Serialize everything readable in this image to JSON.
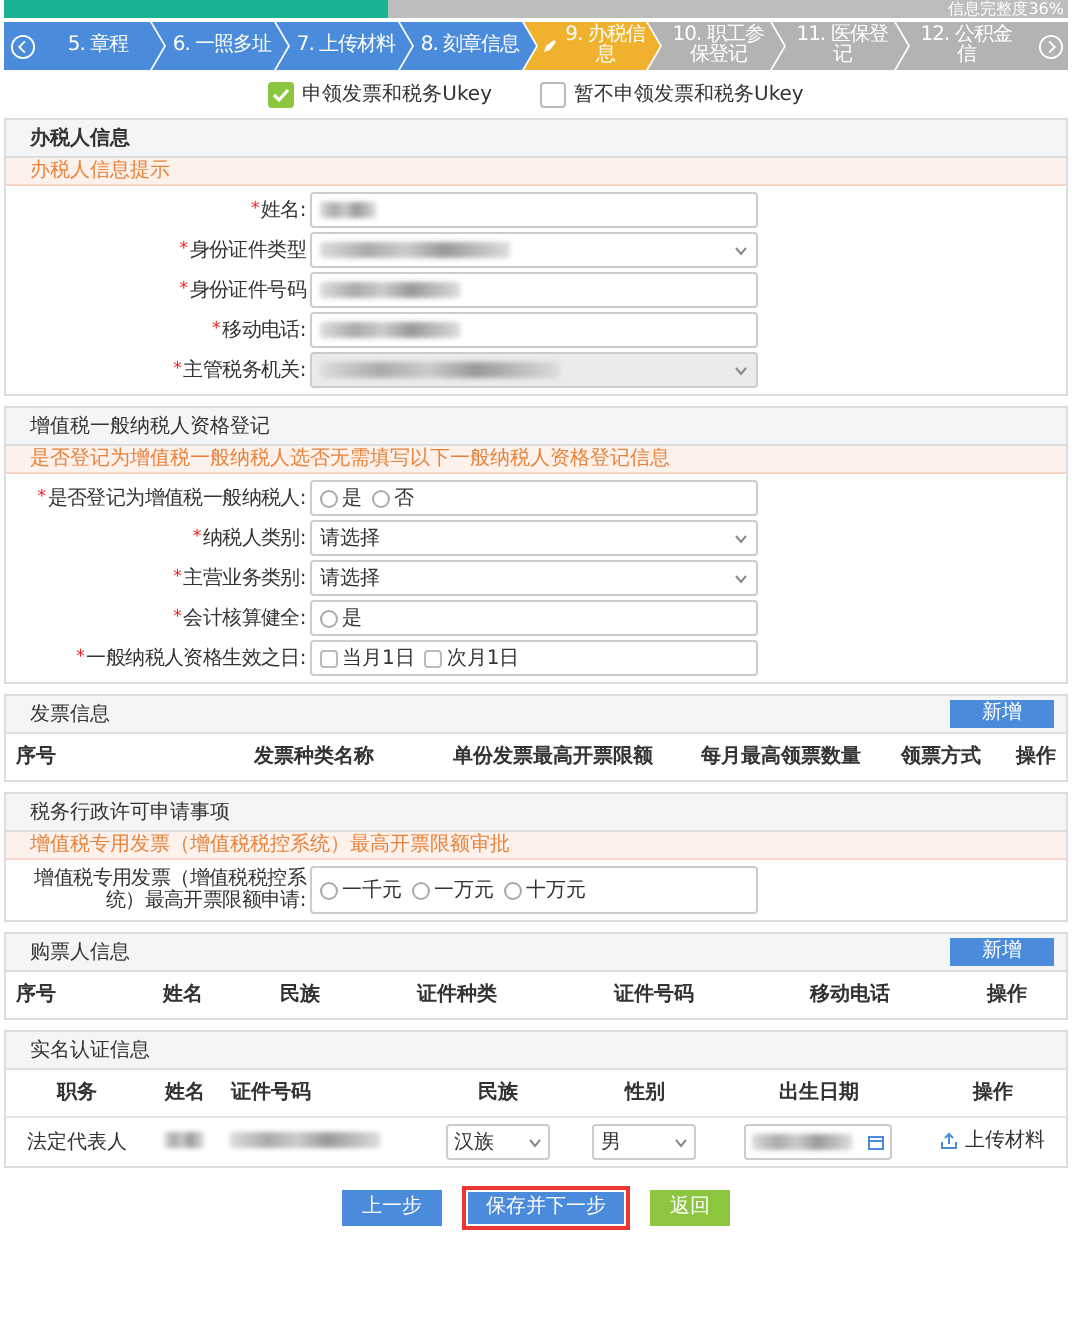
{
  "progress": {
    "level": 0.36,
    "label": "信息完整度36%"
  },
  "steps": [
    {
      "label": "5. 章程",
      "completed": true,
      "selected": false
    },
    {
      "label": "6. 一照多址",
      "completed": true,
      "selected": false
    },
    {
      "label": "7. 上传材料",
      "completed": true,
      "selected": false
    },
    {
      "label": "8. 刻章信息",
      "completed": true,
      "selected": false
    },
    {
      "label": "9. 办税信息",
      "selected": true
    },
    {
      "label": "10. 职工参保登记",
      "completed": false,
      "selected": false
    },
    {
      "label": "11. 医保登记",
      "completed": false,
      "selected": false
    },
    {
      "label": "12. 公积金信",
      "completed": false,
      "selected": false
    }
  ],
  "ukey_options": [
    {
      "label": "申领发票和税务Ukey",
      "checked": true
    },
    {
      "label": "暂不申领发票和税务Ukey",
      "checked": false
    }
  ],
  "sections": [
    {
      "kind": "form",
      "title": "办税人信息",
      "title_bold": true,
      "hint": "办税人信息提示",
      "fields": [
        {
          "marker": "*",
          "label": "姓名:",
          "kind": "text",
          "blurred": true
        },
        {
          "marker": "*",
          "label": "身份证件类型",
          "kind": "select",
          "blurred": true
        },
        {
          "marker": "*",
          "label": "身份证件号码",
          "kind": "text",
          "blurred": true
        },
        {
          "marker": "*",
          "label": "移动电话:",
          "kind": "text",
          "blurred": true
        },
        {
          "marker": "*",
          "label": "主管税务机关:",
          "kind": "select",
          "blurred": true,
          "disabled": true
        }
      ]
    },
    {
      "kind": "form",
      "title": "增值税一般纳税人资格登记",
      "hint": "是否登记为增值税一般纳税人选否无需填写以下一般纳税人资格登记信息",
      "fields": [
        {
          "marker": "*",
          "label": "是否登记为增值税一般纳税人:",
          "kind": "radio",
          "options": [
            {
              "label": "是",
              "selected": false
            },
            {
              "label": "否",
              "selected": false
            }
          ]
        },
        {
          "marker": "*",
          "label": "纳税人类别:",
          "kind": "select",
          "value": "请选择"
        },
        {
          "marker": "*",
          "label": "主营业务类别:",
          "kind": "select",
          "value": "请选择"
        },
        {
          "marker": "*",
          "label": "会计核算健全:",
          "kind": "radio",
          "options": [
            {
              "label": "是",
              "selected": false
            }
          ]
        },
        {
          "marker": "*",
          "label": "一般纳税人资格生效之日:",
          "kind": "check",
          "options": [
            {
              "label": "当月1日",
              "selected": false
            },
            {
              "label": "次月1日",
              "selected": false
            }
          ]
        }
      ]
    },
    {
      "kind": "table",
      "title": "发票信息",
      "add_button": "新增",
      "columns": [
        "序号",
        "发票种类名称",
        "单份发票最高开票限额",
        "每月最高领票数量",
        "领票方式",
        "操作"
      ]
    },
    {
      "kind": "form",
      "title": "税务行政许可申请事项",
      "hint": "增值税专用发票（增值税税控系统）最高开票限额审批",
      "fields": [
        {
          "label": "增值税专用发票（增值税税控系统）最高开票限额申请:",
          "kind": "radio",
          "options": [
            {
              "label": "一千元",
              "selected": false
            },
            {
              "label": "一万元",
              "selected": false
            },
            {
              "label": "十万元",
              "selected": false
            }
          ]
        }
      ]
    },
    {
      "kind": "table",
      "title": "购票人信息",
      "add_button": "新增",
      "columns": [
        "序号",
        "姓名",
        "民族",
        "证件种类",
        "证件号码",
        "移动电话",
        "操作"
      ]
    },
    {
      "kind": "table",
      "title": "实名认证信息",
      "columns": [
        "职务",
        "姓名",
        "证件号码",
        "民族",
        "性别",
        "出生日期",
        "操作"
      ],
      "rows": [
        [
          {
            "kind": "text",
            "text": "法定代表人"
          },
          {
            "kind": "blurred"
          },
          {
            "kind": "blurred"
          },
          {
            "kind": "select",
            "value": "汉族"
          },
          {
            "kind": "select",
            "value": "男"
          },
          {
            "kind": "date"
          },
          {
            "kind": "upload",
            "text": "上传材料"
          }
        ]
      ]
    }
  ],
  "buttons": [
    {
      "label": "上一步",
      "kind": "primary",
      "highlighted": false
    },
    {
      "label": "保存并下一步",
      "kind": "primary",
      "highlighted": true
    },
    {
      "label": "返回",
      "kind": "success",
      "highlighted": false
    }
  ]
}
